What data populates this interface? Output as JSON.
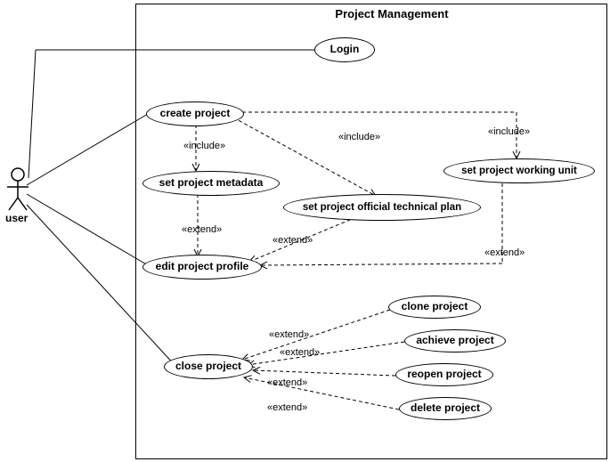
{
  "diagram": {
    "title": "Project Management",
    "actor": "user",
    "usecases": {
      "login": "Login",
      "create": "create project",
      "set_metadata": "set project metadata",
      "set_plan": "set project official technical plan",
      "set_unit": "set project working unit",
      "edit_profile": "edit project profile",
      "close": "close project",
      "clone": "clone project",
      "achieve": "achieve project",
      "reopen": "reopen project",
      "delete": "delete project"
    },
    "stereotypes": {
      "include": "«include»",
      "extend": "«extend»"
    }
  }
}
